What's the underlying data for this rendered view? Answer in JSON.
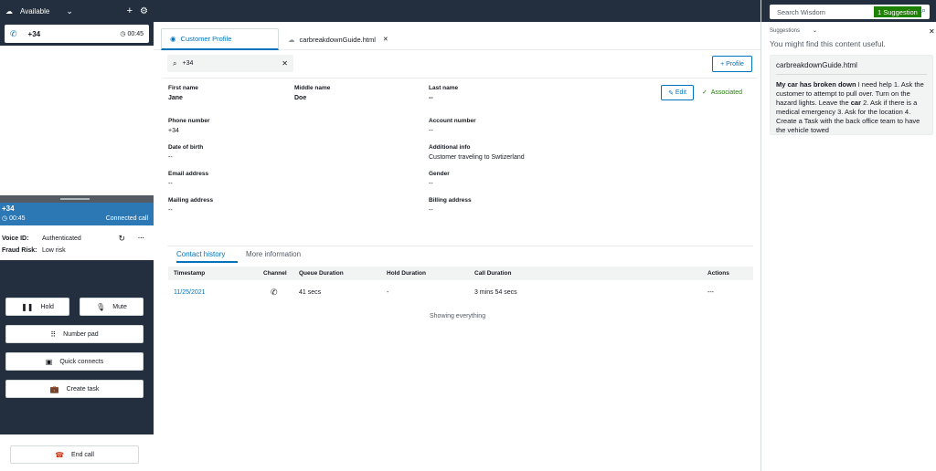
{
  "ccp": {
    "status": "Available",
    "contact_number": "+34",
    "contact_timer": "00:45",
    "connected": {
      "number": "+34",
      "timer": "00:45",
      "state": "Connected call"
    },
    "voice_id_label": "Voice ID:",
    "voice_id_value": "Authenticated",
    "fraud_label": "Fraud Risk:",
    "fraud_value": "Low risk",
    "hold_label": "Hold",
    "mute_label": "Mute",
    "numpad_label": "Number pad",
    "quick_connects_label": "Quick connects",
    "create_task_label": "Create task",
    "end_call_label": "End call"
  },
  "tabs": {
    "profile": "Customer Profile",
    "guide": "carbreakdownGuide.html"
  },
  "search": {
    "value": "+34"
  },
  "profile_button": "+ Profile",
  "profile": {
    "first_name_label": "First name",
    "first_name": "Jane",
    "middle_name_label": "Middle name",
    "middle_name": "Doe",
    "last_name_label": "Last name",
    "last_name": "--",
    "edit_label": "Edit",
    "associated_label": "Associated",
    "phone_label": "Phone number",
    "phone": "+34",
    "account_label": "Account number",
    "account": "--",
    "dob_label": "Date of birth",
    "dob": "--",
    "additional_label": "Additional info",
    "additional": "Customer traveling to Swtizerland",
    "email_label": "Email address",
    "email": "--",
    "gender_label": "Gender",
    "gender": "--",
    "mailing_label": "Mailing address",
    "mailing": "--",
    "billing_label": "Billing address",
    "billing": "--"
  },
  "history": {
    "tab_history": "Contact history",
    "tab_more": "More information",
    "columns": [
      "Timestamp",
      "Channel",
      "Queue Duration",
      "Hold Duration",
      "Call Duration",
      "Actions"
    ],
    "rows": [
      {
        "timestamp": "11/25/2021",
        "queue": "41 secs",
        "hold": "-",
        "call": "3 mins 54 secs",
        "actions": "---"
      }
    ],
    "footer": "Showing everything"
  },
  "wisdom": {
    "search_placeholder": "Search Wisdom",
    "suggestion_badge": "1 Suggestion",
    "suggestions_label": "Suggestions",
    "message": "You might find this content useful.",
    "card_title": "carbreakdownGuide.html",
    "card_bold": "My car has broken down",
    "card_text_1": " I need help 1. Ask the customer to attempt to pull over. Turn on the hazard lights. Leave the ",
    "card_bold_2": "car",
    "card_text_2": " 2. Ask if there is a medical emergency 3. Ask for the location 4. Create a Task with the back office team to have the vehicle towed"
  },
  "colors": {
    "navy": "#232f3e",
    "accent": "#0073bb",
    "connected": "#2b78b4",
    "success": "#1d8102",
    "endcall": "#d13212"
  }
}
